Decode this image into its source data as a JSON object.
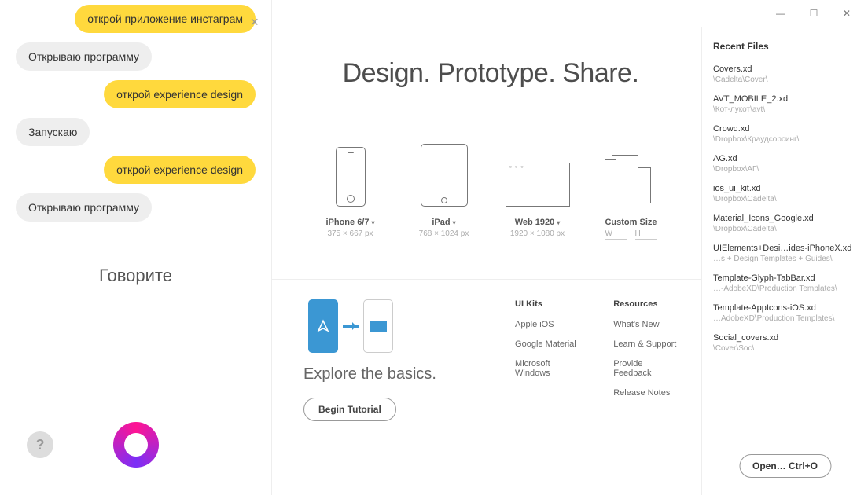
{
  "assistant": {
    "messages": [
      {
        "side": "right",
        "kind": "user",
        "text": "открой приложение инстаграм"
      },
      {
        "side": "left",
        "kind": "bot",
        "text": "Открываю программу"
      },
      {
        "side": "right",
        "kind": "user",
        "text": "открой experience design"
      },
      {
        "side": "left",
        "kind": "bot",
        "text": "Запускаю"
      },
      {
        "side": "right",
        "kind": "user",
        "text": "открой experience design"
      },
      {
        "side": "left",
        "kind": "bot",
        "text": "Открываю программу"
      }
    ],
    "speak_label": "Говорите",
    "help_label": "?"
  },
  "xd": {
    "headline": "Design. Prototype. Share.",
    "presets": {
      "iphone": {
        "label": "iPhone 6/7",
        "dims": "375 × 667 px"
      },
      "ipad": {
        "label": "iPad",
        "dims": "768 × 1024 px"
      },
      "web": {
        "label": "Web 1920",
        "dims": "1920 × 1080 px"
      },
      "custom": {
        "label": "Custom Size",
        "w": "W",
        "h": "H"
      }
    },
    "tutorial": {
      "title": "Explore the basics.",
      "button": "Begin Tutorial"
    },
    "uikits": {
      "heading": "UI Kits",
      "items": [
        "Apple iOS",
        "Google Material",
        "Microsoft Windows"
      ]
    },
    "resources": {
      "heading": "Resources",
      "items": [
        "What's New",
        "Learn & Support",
        "Provide Feedback",
        "Release Notes"
      ]
    },
    "recent": {
      "heading": "Recent Files",
      "files": [
        {
          "name": "Covers.xd",
          "path": "\\Cadelta\\Cover\\"
        },
        {
          "name": "AVT_MOBILE_2.xd",
          "path": "\\Кот-лукот\\avt\\"
        },
        {
          "name": "Crowd.xd",
          "path": "\\Dropbox\\Краудсорсинг\\"
        },
        {
          "name": "AG.xd",
          "path": "\\Dropbox\\АГ\\"
        },
        {
          "name": "ios_ui_kit.xd",
          "path": "\\Dropbox\\Cadelta\\"
        },
        {
          "name": "Material_Icons_Google.xd",
          "path": "\\Dropbox\\Cadelta\\"
        },
        {
          "name": "UIElements+Desi…ides-iPhoneX.xd",
          "path": "…s + Design Templates + Guides\\"
        },
        {
          "name": "Template-Glyph-TabBar.xd",
          "path": "…-AdobeXD\\Production Templates\\"
        },
        {
          "name": "Template-AppIcons-iOS.xd",
          "path": "…AdobeXD\\Production Templates\\"
        },
        {
          "name": "Social_covers.xd",
          "path": "\\Cover\\Soc\\"
        }
      ],
      "open_button": "Open…   Ctrl+O"
    }
  }
}
